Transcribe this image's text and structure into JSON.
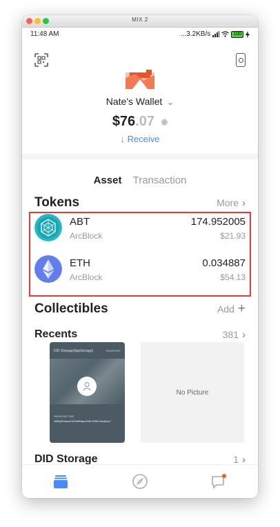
{
  "window": {
    "title": "MIX 2"
  },
  "status_bar": {
    "time": "11:48 AM",
    "network_speed": "...3.2KB/s",
    "battery": "100"
  },
  "wallet": {
    "name": "Nate's Wallet",
    "balance_whole": "$76",
    "balance_decimal": ".07",
    "receive_label": "↓ Receive"
  },
  "tabs": {
    "asset": "Asset",
    "transaction": "Transaction"
  },
  "tokens_section": {
    "title": "Tokens",
    "more_label": "More"
  },
  "tokens": [
    {
      "symbol": "ABT",
      "issuer": "ArcBlock",
      "amount": "174.952005",
      "usd": "$21.93"
    },
    {
      "symbol": "ETH",
      "issuer": "ArcBlock",
      "amount": "0.034887",
      "usd": "$54.13"
    }
  ],
  "collectibles": {
    "title": "Collectibles",
    "add_label": "Add"
  },
  "recents": {
    "title": "Recents",
    "count": "381"
  },
  "recent_cards": {
    "card1": {
      "title": "DID Storage(AppStorage)",
      "passport": "PASSPORT",
      "did_label": "PASSPORT DID",
      "address": "zNKtyRmoxuFeXfvMHpacTaSLDSfbYxbqDzz7"
    },
    "card2": {
      "placeholder": "No Picture"
    }
  },
  "did_storage": {
    "title": "DID Storage",
    "count": "1"
  },
  "colors": {
    "accent": "#4a8af4",
    "highlight": "#e53935",
    "notification": "#ff5722"
  }
}
